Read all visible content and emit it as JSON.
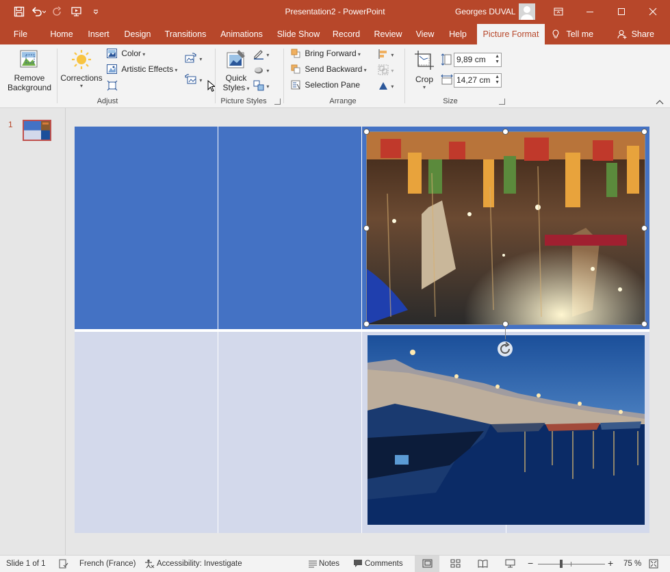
{
  "window": {
    "title": "Presentation2  -  PowerPoint",
    "user_name": "Georges DUVAL"
  },
  "tabs": [
    {
      "label": "File"
    },
    {
      "label": "Home"
    },
    {
      "label": "Insert"
    },
    {
      "label": "Design"
    },
    {
      "label": "Transitions"
    },
    {
      "label": "Animations"
    },
    {
      "label": "Slide Show"
    },
    {
      "label": "Record"
    },
    {
      "label": "Review"
    },
    {
      "label": "View"
    },
    {
      "label": "Help"
    },
    {
      "label": "Picture Format"
    }
  ],
  "tell_me": "Tell me",
  "share": "Share",
  "ribbon": {
    "remove_background": {
      "line1": "Remove",
      "line2": "Background"
    },
    "corrections": "Corrections",
    "color": "Color",
    "artistic_effects": "Artistic Effects",
    "adjust_label": "Adjust",
    "quick_styles": {
      "line1": "Quick",
      "line2": "Styles"
    },
    "picture_styles_label": "Picture Styles",
    "bring_forward": "Bring Forward",
    "send_backward": "Send Backward",
    "selection_pane": "Selection Pane",
    "arrange_label": "Arrange",
    "crop": "Crop",
    "height_value": "9,89 cm",
    "width_value": "14,27 cm",
    "size_label": "Size"
  },
  "thumbnail": {
    "number": "1"
  },
  "status": {
    "slide_info": "Slide 1 of 1",
    "language": "French (France)",
    "accessibility": "Accessibility: Investigate",
    "notes": "Notes",
    "comments": "Comments",
    "zoom": "75 %"
  },
  "colors": {
    "accent": "#b7472a",
    "slide_blue_dark": "#4472c4",
    "slide_blue_light": "#d3d9eb"
  }
}
